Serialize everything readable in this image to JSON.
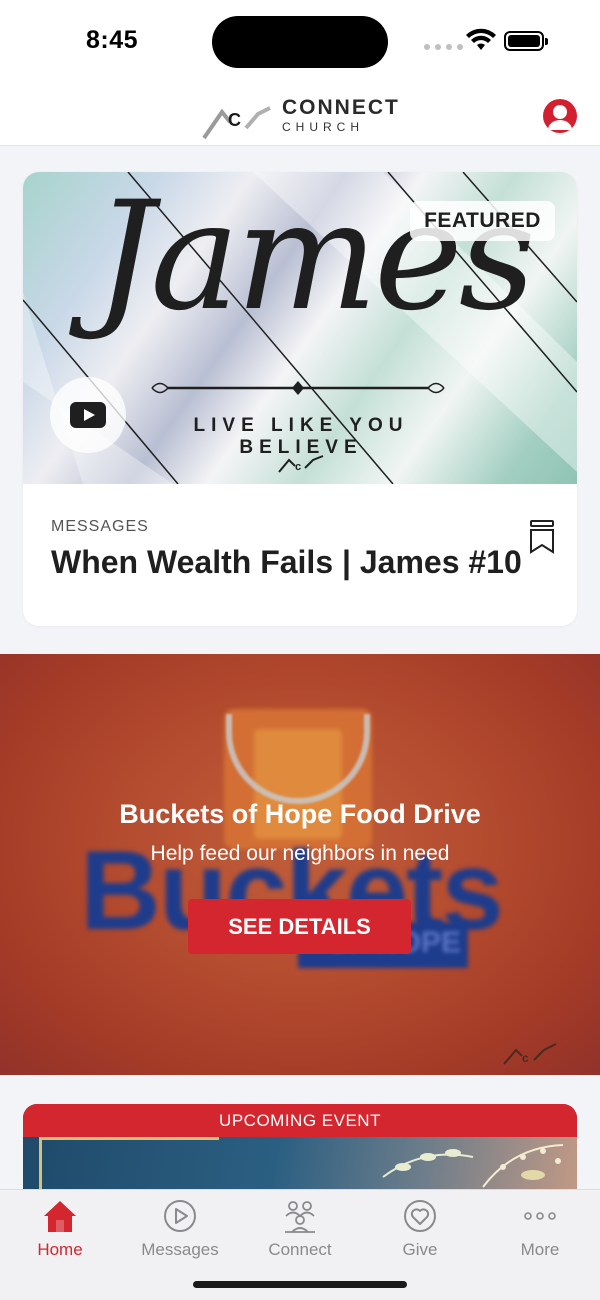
{
  "status_bar": {
    "time": "8:45"
  },
  "header": {
    "logo_word": "CONNECT",
    "logo_sub": "CHURCH",
    "logo_mark": "C"
  },
  "featured": {
    "badge": "FEATURED",
    "art_title": "James",
    "art_subtitle": "LIVE LIKE YOU BELIEVE",
    "category": "MESSAGES",
    "title": "When Wealth Fails | James #10"
  },
  "promo": {
    "art_word": "Buckets",
    "art_sub": "OF HOPE",
    "title": "Buckets of Hope Food Drive",
    "subtitle": "Help feed our neighbors in need",
    "button_label": "SEE DETAILS"
  },
  "event": {
    "header": "UPCOMING EVENT"
  },
  "tabs": [
    {
      "label": "Home",
      "icon": "home-icon",
      "active": true
    },
    {
      "label": "Messages",
      "icon": "play-circle-icon",
      "active": false
    },
    {
      "label": "Connect",
      "icon": "people-icon",
      "active": false
    },
    {
      "label": "Give",
      "icon": "heart-icon",
      "active": false
    },
    {
      "label": "More",
      "icon": "more-icon",
      "active": false
    }
  ],
  "colors": {
    "accent": "#d3262f",
    "inactive_tab": "#8a8a8e",
    "background": "#f3f4f8"
  }
}
